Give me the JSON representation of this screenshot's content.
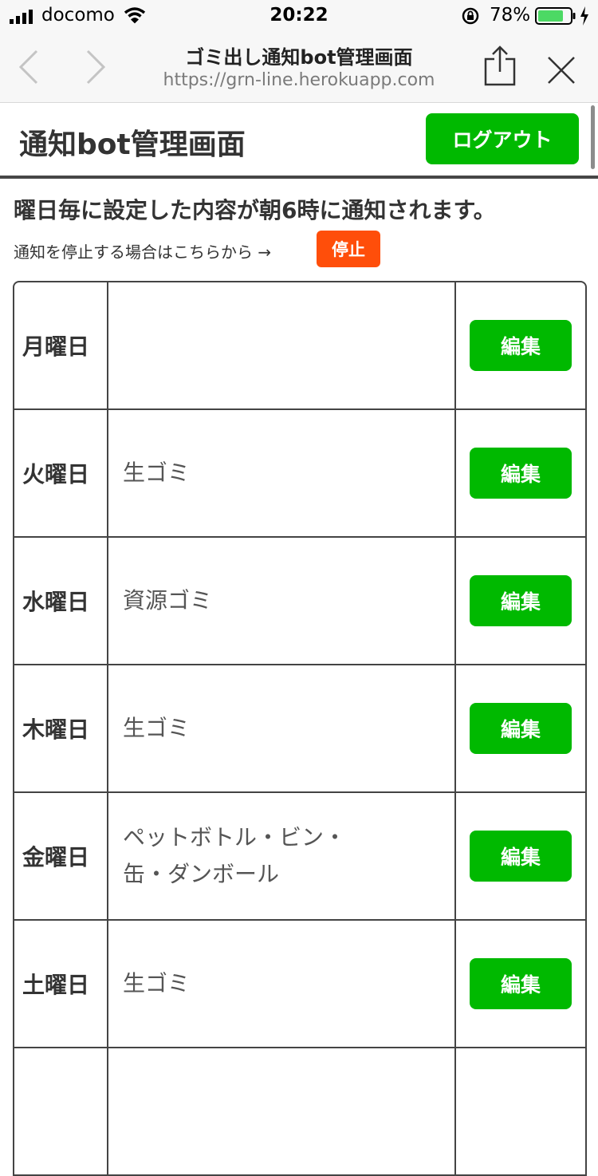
{
  "status": {
    "carrier": "docomo",
    "time": "20:22",
    "battery": "78%"
  },
  "browser": {
    "title": "ゴミ出し通知bot管理画面",
    "url": "https://grn-line.herokuapp.com"
  },
  "header": {
    "title": "通知bot管理画面",
    "logout_label": "ログアウト"
  },
  "notice": "曜日毎に設定した内容が朝6時に通知されます。",
  "stop": {
    "text": "通知を停止する場合はこちらから →",
    "button": "停止"
  },
  "edit_label": "編集",
  "schedule": [
    {
      "day": "月曜日",
      "content": ""
    },
    {
      "day": "火曜日",
      "content": "生ゴミ"
    },
    {
      "day": "水曜日",
      "content": "資源ゴミ"
    },
    {
      "day": "木曜日",
      "content": "生ゴミ"
    },
    {
      "day": "金曜日",
      "content": "ペットボトル・ビン・\n缶・ダンボール"
    },
    {
      "day": "土曜日",
      "content": "生ゴミ"
    },
    {
      "day": "",
      "content": ""
    }
  ],
  "colors": {
    "accent": "#00b900",
    "stop": "#ff4e0a"
  }
}
